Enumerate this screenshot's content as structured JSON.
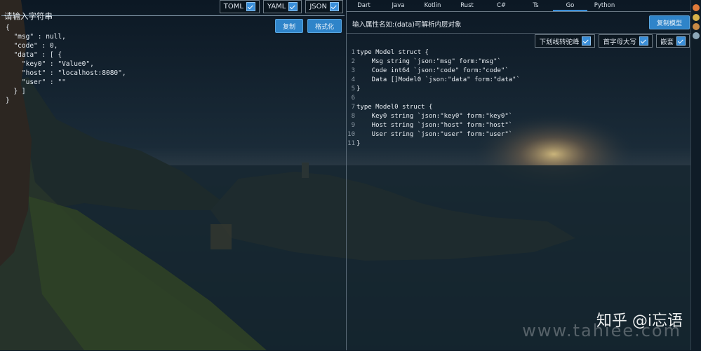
{
  "left": {
    "formats": [
      {
        "label": "TOML",
        "checked": true
      },
      {
        "label": "YAML",
        "checked": true
      },
      {
        "label": "JSON",
        "checked": true
      }
    ],
    "legend": "请输入字符串",
    "copy_label": "复制",
    "format_label": "格式化",
    "json_lines": [
      "{",
      "  \"msg\" : null,",
      "  \"code\" : 0,",
      "  \"data\" : [ {",
      "    \"key0\" : \"Value0\",",
      "    \"host\" : \"localhost:8080\",",
      "    \"user\" : \"\"",
      "  } ]",
      "}"
    ]
  },
  "right": {
    "tabs": [
      "Dart",
      "Java",
      "Kotlin",
      "Rust",
      "C#",
      "Ts",
      "Go",
      "Python"
    ],
    "active_tab": "Go",
    "attr_placeholder": "输入属性名如:(data)可解析内层对象",
    "copy_model_label": "复制模型",
    "options": [
      {
        "label": "下划线转驼峰",
        "checked": true
      },
      {
        "label": "首字母大写",
        "checked": true
      },
      {
        "label": "嵌套",
        "checked": true
      }
    ],
    "code_lines": [
      {
        "n": "1",
        "text": "type Model struct {"
      },
      {
        "n": "2",
        "text": "    Msg string `json:\"msg\" form:\"msg\"`"
      },
      {
        "n": "3",
        "text": "    Code int64 `json:\"code\" form:\"code\"`"
      },
      {
        "n": "4",
        "text": "    Data []Model0 `json:\"data\" form:\"data\"`"
      },
      {
        "n": "5",
        "text": "}"
      },
      {
        "n": "6",
        "text": ""
      },
      {
        "n": "7",
        "text": "type Model0 struct {"
      },
      {
        "n": "8",
        "text": "    Key0 string `json:\"key0\" form:\"key0\"`"
      },
      {
        "n": "9",
        "text": "    Host string `json:\"host\" form:\"host\"`"
      },
      {
        "n": "10",
        "text": "    User string `json:\"user\" form:\"user\"`"
      },
      {
        "n": "11",
        "text": "}"
      }
    ]
  },
  "watermark": "知乎 @i忘语",
  "watermark_url": "www.tahiee.com",
  "colors": {
    "accent": "#2f84c9",
    "checkbox": "#3b8fd9"
  }
}
